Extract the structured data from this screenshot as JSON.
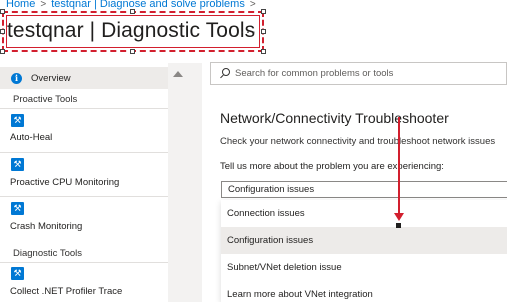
{
  "breadcrumb": {
    "items": [
      "Home",
      "testqnar | Diagnose and solve problems"
    ]
  },
  "header": {
    "title": "testqnar | Diagnostic Tools",
    "more": "···"
  },
  "sidebar": {
    "overview": {
      "label": "Overview",
      "icon": "info-icon"
    },
    "proactive_section": "Proactive Tools",
    "proactive_tools": [
      {
        "label": "Auto-Heal",
        "icon": "tool-icon"
      },
      {
        "label": "Proactive CPU Monitoring",
        "icon": "tool-icon"
      },
      {
        "label": "Crash Monitoring",
        "icon": "tool-icon"
      }
    ],
    "diagnostic_section": "Diagnostic Tools",
    "diagnostic_tools": [
      {
        "label": "Collect .NET Profiler Trace",
        "icon": "tool-icon"
      }
    ]
  },
  "search": {
    "placeholder": "Search for common problems or tools"
  },
  "main": {
    "heading": "Network/Connectivity Troubleshooter",
    "description": "Check your network connectivity and troubleshoot network issues",
    "prompt": "Tell us more about the problem you are experiencing:",
    "dropdown": {
      "selected": "Configuration issues",
      "options": [
        "Connection issues",
        "Configuration issues",
        "Subnet/VNet deletion issue",
        "Learn more about VNet integration"
      ],
      "highlighted_index": 1
    }
  },
  "colors": {
    "accent": "#0078d4",
    "annotation": "#d21f2e"
  }
}
